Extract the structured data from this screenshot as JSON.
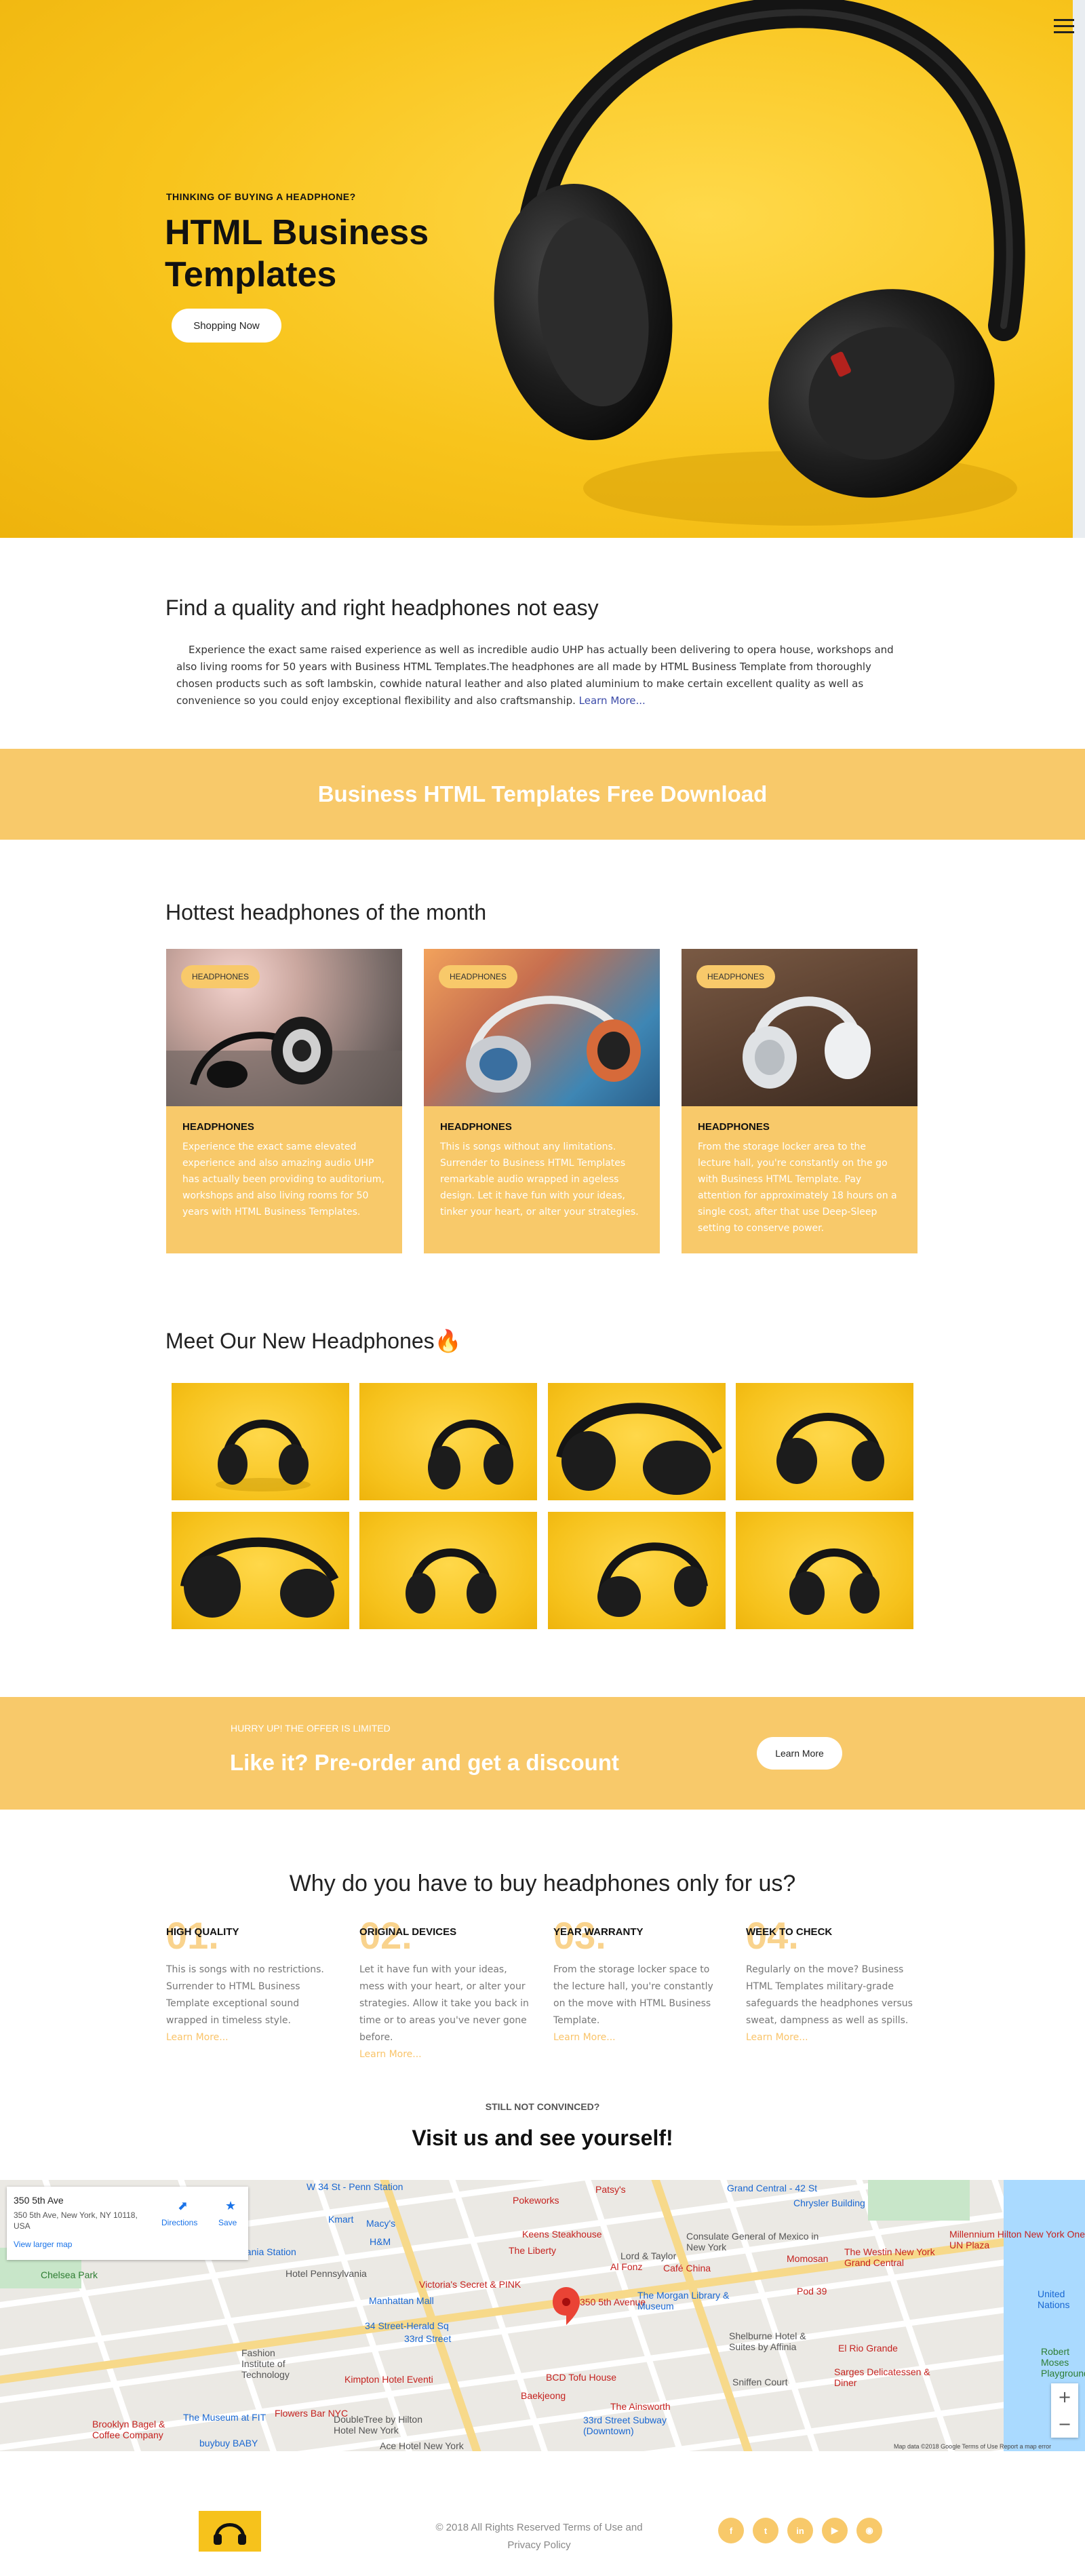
{
  "hero": {
    "kicker": "THINKING OF BUYING A HEADPHONE?",
    "title": "HTML Business Templates",
    "button": "Shopping Now",
    "menu_icon": "hamburger-menu-icon"
  },
  "intro": {
    "title": "Find a quality and right headphones not easy",
    "text": "Experience the exact same raised experience as well as incredible audio UHP has actually been delivering to opera house, workshops and also living rooms for 50 years with Business HTML Templates.The headphones are all made by HTML Business Template from thoroughly chosen products such as soft lambskin, cowhide natural leather and also plated aluminium to make certain excellent quality as well as convenience so you could enjoy exceptional flexibility and also craftsmanship.",
    "link": "Learn More..."
  },
  "banner1": {
    "text": "Business HTML Templates Free Download"
  },
  "hottest": {
    "title": "Hottest headphones of the month",
    "cards": [
      {
        "tag": "HEADPHONES",
        "title": "HEADPHONES",
        "text": "Experience the exact same elevated experience and also amazing audio UHP has actually been providing to auditorium, workshops and also living rooms for 50 years with HTML Business Templates."
      },
      {
        "tag": "HEADPHONES",
        "title": "HEADPHONES",
        "text": "This is songs without any limitations. Surrender to Business HTML Templates remarkable audio wrapped in ageless design. Let it have fun with your ideas, tinker your heart, or alter your strategies."
      },
      {
        "tag": "HEADPHONES",
        "title": "HEADPHONES",
        "text": "From the storage locker area to the lecture hall, you're constantly on the go with Business HTML Template. Pay attention for approximately 18 hours on a single cost, after that use Deep-Sleep setting to conserve power."
      }
    ]
  },
  "gallery": {
    "title": "Meet Our New Headphones",
    "emoji": "🔥"
  },
  "preorder": {
    "small": "HURRY UP! THE OFFER IS LIMITED",
    "big": "Like it? Pre-order and get a discount",
    "button": "Learn More"
  },
  "why": {
    "title": "Why do you have to buy headphones only for us?",
    "features": [
      {
        "num": "01.",
        "title": "HIGH QUALITY",
        "text": "This is songs with no restrictions. Surrender to HTML Business Template exceptional sound wrapped in timeless style.",
        "link": "Learn More..."
      },
      {
        "num": "02.",
        "title": "ORIGINAL DEVICES",
        "text": "Let it have fun with your ideas, mess with your heart, or alter your strategies. Allow it take you back in time or to areas you've never gone before.",
        "link": "Learn More..."
      },
      {
        "num": "03.",
        "title": "YEAR WARRANTY",
        "text": "From the storage locker space to the lecture hall, you're constantly on the move with HTML Business Template.",
        "link": "Learn More..."
      },
      {
        "num": "04.",
        "title": "WEEK TO CHECK",
        "text": "Regularly on the move? Business HTML Templates military-grade safeguards the headphones versus sweat, dampness as well as spills.",
        "link": "Learn More..."
      }
    ]
  },
  "visit": {
    "small": "STILL NOT CONVINCED?",
    "big": "Visit us and see yourself!"
  },
  "map": {
    "place_name": "350 5th Ave",
    "address": "350 5th Ave, New York, NY 10118, USA",
    "larger_map": "View larger map",
    "directions": "Directions",
    "save": "Save",
    "pin_label": "350 5th Avenue",
    "labels": [
      "W 34 St - Penn Station",
      "Grand Central - 42 St",
      "Chrysler Building",
      "Macy's",
      "Kmart",
      "H&M",
      "Pennsylvania Station",
      "Hotel Pennsylvania",
      "Keens Steakhouse",
      "Lord & Taylor",
      "Consulate General of Mexico in New York",
      "The Westin New York Grand Central",
      "Millennium Hilton New York One UN Plaza",
      "Chelsea Park",
      "Victoria's Secret & PINK",
      "The Morgan Library & Museum",
      "Manhattan Mall",
      "34 Street-Herald Sq",
      "33rd Street",
      "Fashion Institute of Technology",
      "Kimpton Hotel Eventi",
      "Shelburne Hotel & Suites by Affinia",
      "El Rio Grande",
      "Sarges Delicatessen & Diner",
      "Sniffen Court",
      "BCD Tofu House",
      "Baekjeong",
      "Flowers Bar NYC",
      "The Museum at FIT",
      "DoubleTree by Hilton Hotel New York",
      "The Ainsworth",
      "33rd Street Subway (Downtown)",
      "Brooklyn Bagel & Coffee Company",
      "Ace Hotel New York",
      "buybuy BABY",
      "United Nations",
      "Robert Moses Playground",
      "Patsy's",
      "Pokeworks",
      "The Liberty",
      "Al Fonz",
      "Café China",
      "Momosan",
      "Pod 39"
    ],
    "zoom_in": "+",
    "zoom_out": "−",
    "footer": "Map data ©2018 Google   Terms of Use   Report a map error"
  },
  "footer": {
    "copyright": "© 2018 All Rights Reserved Terms of Use and Privacy Policy",
    "social": [
      {
        "icon": "facebook-icon",
        "glyph": "f"
      },
      {
        "icon": "twitter-icon",
        "glyph": "t"
      },
      {
        "icon": "linkedin-icon",
        "glyph": "in"
      },
      {
        "icon": "youtube-icon",
        "glyph": "▶"
      },
      {
        "icon": "rss-icon",
        "glyph": "◉"
      }
    ]
  },
  "colors": {
    "accent": "#f8c96a",
    "hero_yellow": "#f8c41c",
    "link": "#3c4ba8",
    "feature_number": "#f9d38d"
  }
}
